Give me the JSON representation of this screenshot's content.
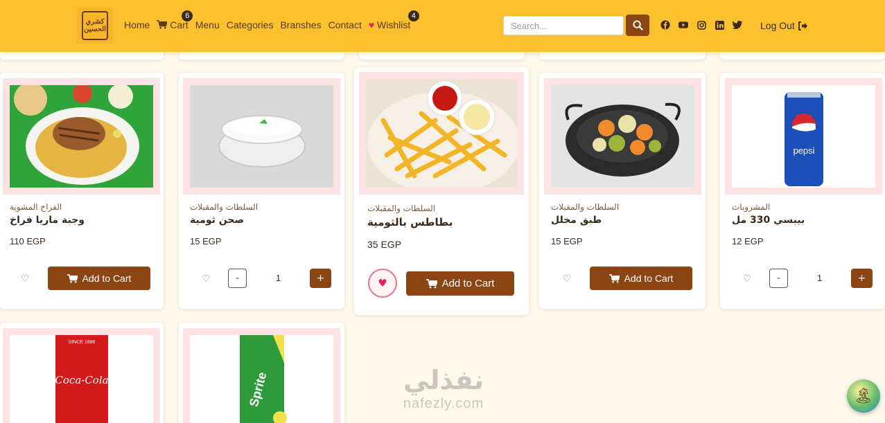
{
  "nav": {
    "logo_text_line1": "كشري",
    "logo_text_line2": "الحسين",
    "links": {
      "home": "Home",
      "cart": "Cart",
      "menu": "Menu",
      "categories": "Categories",
      "branches": "Branshes",
      "contact": "Contact",
      "wishlist": "Wishlist"
    },
    "cart_count": "6",
    "wishlist_count": "4",
    "search_placeholder": "Search...",
    "logout": "Log Out"
  },
  "products": [
    {
      "category": "الفراخ المشوية",
      "name": "وجبة ماريا فراخ",
      "price": "110 EGP",
      "action": "Add to Cart"
    },
    {
      "category": "السلطات والمقبلات",
      "name": "صحن ثومية",
      "price": "15 EGP",
      "qty": "1",
      "minus": "-",
      "plus": "+"
    },
    {
      "category": "السلطات والمقبلات",
      "name": "بطاطس بالثومية",
      "price": "35 EGP",
      "action": "Add to Cart"
    },
    {
      "category": "السلطات والمقبلات",
      "name": "طبق مخلل",
      "price": "15 EGP",
      "action": "Add to Cart"
    },
    {
      "category": "المشروبات",
      "name": "بيبسي 330 مل",
      "price": "12 EGP",
      "qty": "1",
      "minus": "-",
      "plus": "+"
    }
  ],
  "drink_labels": {
    "pepsi": "pepsi",
    "coca_cola": "Coca-Cola",
    "coca_since": "SINCE 1886",
    "sprite": "Sprite"
  },
  "watermark": {
    "arabic": "نفذلي",
    "latin": "nafezly.com"
  },
  "colors": {
    "navbar": "#fbc02d",
    "button": "#8b4513",
    "page_bg": "#fdf8ea",
    "image_frame": "#fde3e3"
  }
}
